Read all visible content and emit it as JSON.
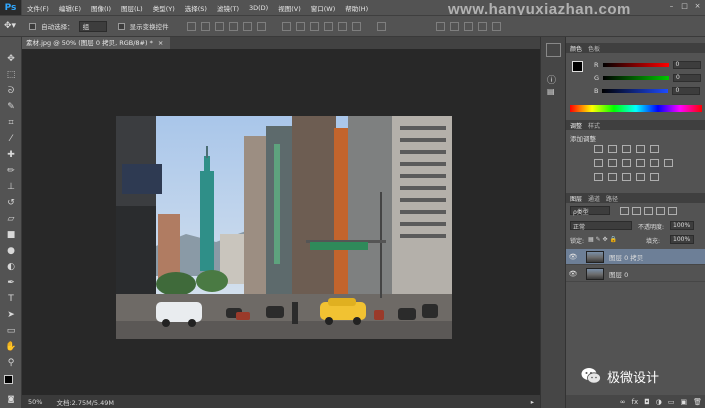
{
  "app": {
    "logo": "Ps",
    "watermark": "www.hanyuxiazhan.com"
  },
  "menu": [
    "文件(F)",
    "编辑(E)",
    "图像(I)",
    "图层(L)",
    "类型(Y)",
    "选择(S)",
    "滤镜(T)",
    "3D(D)",
    "视图(V)",
    "窗口(W)",
    "帮助(H)"
  ],
  "options": {
    "auto_select_label": "自动选择：",
    "auto_select_value": "组",
    "show_transform_label": "显示变换控件"
  },
  "document": {
    "tab_title": "素材.jpg @ 50% (图层 0 拷贝, RGB/8#) *",
    "close": "×"
  },
  "status": {
    "zoom": "50%",
    "doc_size": "文档:2.75M/5.49M"
  },
  "color_panel": {
    "tabs": [
      "颜色",
      "色板"
    ],
    "channels": [
      {
        "label": "R",
        "value": "0"
      },
      {
        "label": "G",
        "value": "0"
      },
      {
        "label": "B",
        "value": "0"
      }
    ]
  },
  "adjust_panel": {
    "tabs": [
      "调整",
      "样式"
    ],
    "title": "添加调整"
  },
  "layers_panel": {
    "tabs": [
      "图层",
      "通道",
      "路径"
    ],
    "filter_label": "ρ类型",
    "blend_mode": "正常",
    "opacity_label": "不透明度:",
    "opacity_value": "100%",
    "lock_label": "锁定:",
    "fill_label": "填充:",
    "fill_value": "100%",
    "layers": [
      {
        "name": "图层 0 拷贝",
        "selected": true
      },
      {
        "name": "图层 0",
        "selected": false
      }
    ]
  },
  "overlay": {
    "wechat_label": "极微设计"
  },
  "colors": {
    "accent": "#31a8ff",
    "workspace": "#282828",
    "panel": "#535353"
  }
}
